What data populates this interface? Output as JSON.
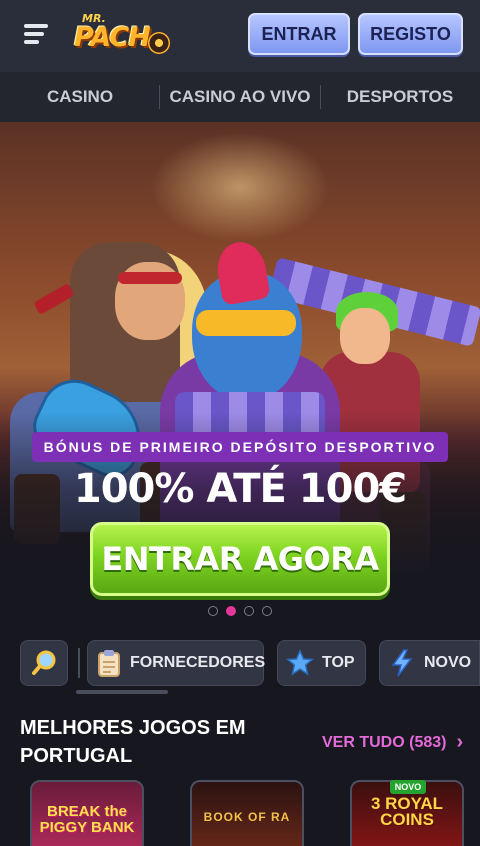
{
  "header": {
    "logo": "MR. PACHO",
    "login_label": "ENTRAR",
    "register_label": "REGISTO"
  },
  "nav": {
    "items": [
      {
        "label": "CASINO"
      },
      {
        "label": "CASINO AO VIVO"
      },
      {
        "label": "DESPORTOS"
      }
    ]
  },
  "banner": {
    "badge": "BÓNUS DE PRIMEIRO DEPÓSITO DESPORTIVO",
    "title": "100% ATÉ 100€",
    "cta_label": "ENTRAR AGORA",
    "slide_count": 4,
    "active_slide": 2
  },
  "filters": {
    "search_icon": "magnifier-icon",
    "items": [
      {
        "label": "FORNECEDORES",
        "icon": "clipboard-icon"
      },
      {
        "label": "TOP",
        "icon": "star-icon"
      },
      {
        "label": "NOVO",
        "icon": "lightning-icon"
      }
    ]
  },
  "section": {
    "title": "MELHORES JOGOS EM PORTUGAL",
    "see_all_label": "VER TUDO (583)"
  },
  "games": [
    {
      "title": "BREAK the PIGGY BANK"
    },
    {
      "title": "BOOK OF RA"
    },
    {
      "title": "3 ROYAL COINS",
      "tag": "NOVO"
    }
  ],
  "colors": {
    "accent_pink": "#e46ad8",
    "cta_green": "#7ed321",
    "badge_purple": "#7d2fb6",
    "header_blue": "#9fb2fa"
  }
}
